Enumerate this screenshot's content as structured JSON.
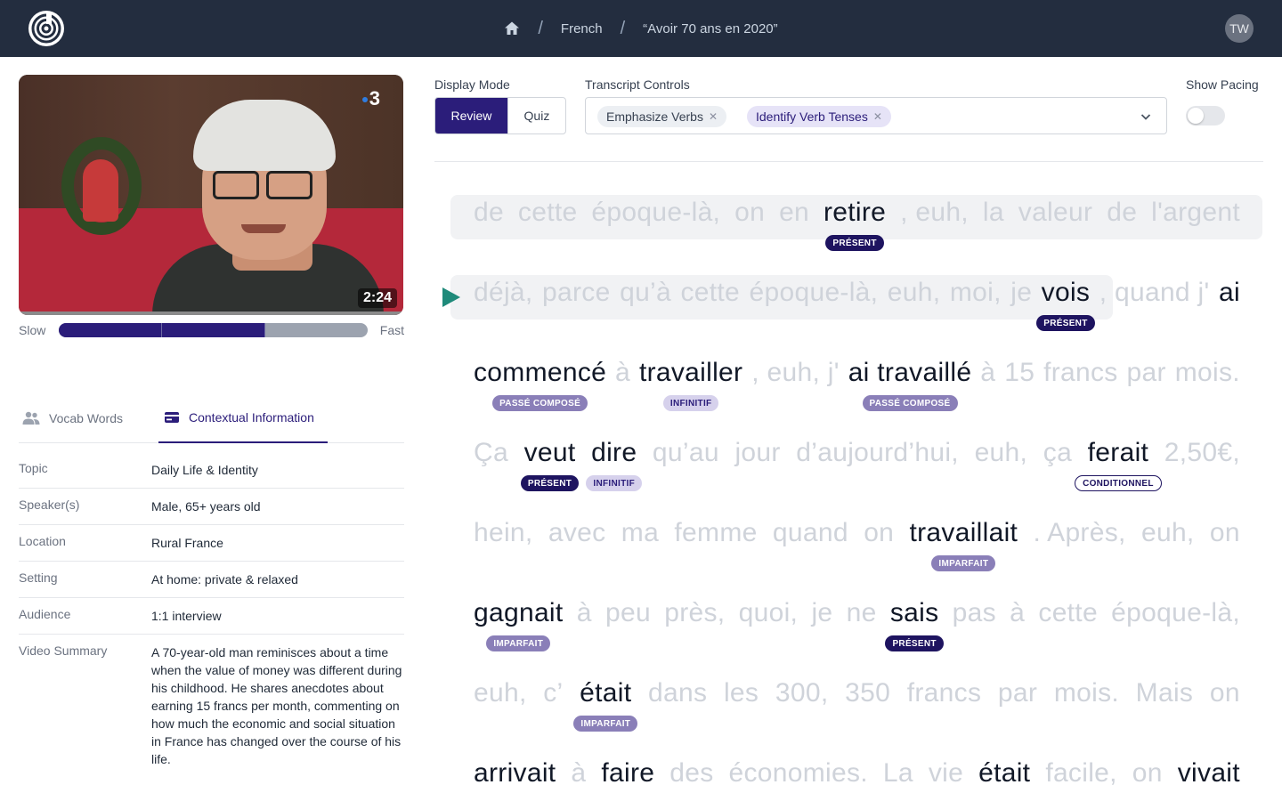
{
  "header": {
    "breadcrumb": [
      "French",
      "“Avoir 70 ans en 2020”"
    ],
    "avatar_initials": "TW"
  },
  "video": {
    "channel": "3",
    "duration": "2:24",
    "speed_slow": "Slow",
    "speed_fast": "Fast",
    "speed_level": 0.67
  },
  "tabs": {
    "vocab": "Vocab Words",
    "context": "Contextual Information",
    "active": "context"
  },
  "info": [
    {
      "key": "Topic",
      "value": "Daily Life & Identity"
    },
    {
      "key": "Speaker(s)",
      "value": "Male, 65+ years old"
    },
    {
      "key": "Location",
      "value": "Rural France"
    },
    {
      "key": "Setting",
      "value": "At home: private & relaxed"
    },
    {
      "key": "Audience",
      "value": "1:1 interview"
    },
    {
      "key": "Video Summary",
      "value": "A 70-year-old man reminisces about a time when the value of money was different during his childhood. He shares anecdotes about earning 15 francs per month, commenting on how much the economic and social situation in France has changed over the course of his life."
    }
  ],
  "controls": {
    "display_mode_label": "Display Mode",
    "mode_review": "Review",
    "mode_quiz": "Quiz",
    "transcript_label": "Transcript Controls",
    "chip_1": "Emphasize Verbs",
    "chip_2": "Identify Verb Tenses",
    "pacing_label": "Show Pacing",
    "pacing_on": false
  },
  "colors": {
    "header_bg": "#232d3f",
    "accent": "#2b1d7a",
    "tag_present": "#1e1460",
    "tag_past": "#8a7fb8",
    "tag_infinitive": "#d6d1ec"
  },
  "transcript": [
    {
      "words": [
        "de",
        "cette",
        "époque-là,",
        "on",
        "en",
        "retire",
        ", euh,",
        "la",
        "valeur",
        "de",
        "l'argent"
      ],
      "dark": [
        5
      ],
      "tags": [
        {
          "word": 5,
          "label": "PRÉSENT",
          "style": "pres"
        }
      ]
    },
    {
      "words": [
        "déjà,",
        "parce",
        "qu’à",
        "cette",
        "époque-là,",
        "euh,",
        "moi,",
        "je",
        "vois",
        ", quand j'",
        "ai"
      ],
      "dark": [
        8,
        10
      ],
      "tags": [
        {
          "word": 8,
          "label": "PRÉSENT",
          "style": "pres"
        }
      ]
    },
    {
      "words": [
        "commencé",
        "à",
        "travailler",
        ", euh, j'",
        "ai travaillé",
        "à",
        "15",
        "francs",
        "par",
        "mois."
      ],
      "dark": [
        0,
        2,
        4
      ],
      "tags": [
        {
          "word": 0,
          "label": "PASSÉ COMPOSÉ",
          "style": "pc"
        },
        {
          "word": 2,
          "label": "INFINITIF",
          "style": "inf"
        },
        {
          "word": 4,
          "label": "PASSÉ COMPOSÉ",
          "style": "pc"
        }
      ]
    },
    {
      "words": [
        "Ça",
        "veut",
        "dire",
        "qu’au",
        "jour",
        "d’aujourd’hui,",
        "euh,",
        "ça",
        "ferait",
        "2,50€,"
      ],
      "dark": [
        1,
        2,
        8
      ],
      "tags": [
        {
          "word": 1,
          "label": "PRÉSENT",
          "style": "pres"
        },
        {
          "word": 2,
          "label": "INFINITIF",
          "style": "inf"
        },
        {
          "word": 8,
          "label": "CONDITIONNEL",
          "style": "cond"
        }
      ]
    },
    {
      "words": [
        "hein,",
        "avec",
        "ma",
        "femme",
        "quand",
        "on",
        "travaillait",
        ". Après,",
        "euh,",
        "on"
      ],
      "dark": [
        6
      ],
      "tags": [
        {
          "word": 6,
          "label": "IMPARFAIT",
          "style": "imp"
        }
      ]
    },
    {
      "words": [
        "gagnait",
        "à",
        "peu",
        "près,",
        "quoi,",
        "je",
        "ne",
        "sais",
        "pas",
        "à",
        "cette",
        "époque-là,"
      ],
      "dark": [
        0,
        7
      ],
      "tags": [
        {
          "word": 0,
          "label": "IMPARFAIT",
          "style": "imp"
        },
        {
          "word": 7,
          "label": "PRÉSENT",
          "style": "pres"
        }
      ]
    },
    {
      "words": [
        "euh,",
        "c’",
        "était",
        "dans",
        "les",
        "300,",
        "350",
        "francs",
        "par",
        "mois.",
        "Mais",
        "on"
      ],
      "dark": [
        2
      ],
      "tags": [
        {
          "word": 2,
          "label": "IMPARFAIT",
          "style": "imp"
        }
      ]
    },
    {
      "words": [
        "arrivait",
        "à",
        "faire",
        "des",
        "économies.",
        "La",
        "vie",
        "était",
        "facile,",
        "on",
        "vivait"
      ],
      "dark": [
        0,
        2,
        7,
        10
      ],
      "tags": []
    }
  ]
}
